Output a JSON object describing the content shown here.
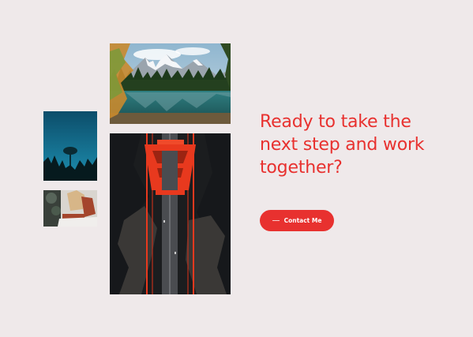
{
  "photos": [
    {
      "name": "photo-mountain-lake",
      "alt": "mountain-lake-photo"
    },
    {
      "name": "photo-tree-sky",
      "alt": "tree-silhouette-photo"
    },
    {
      "name": "photo-person-reading",
      "alt": "person-reading-photo"
    },
    {
      "name": "photo-red-bridge",
      "alt": "red-bridge-aerial-photo"
    }
  ],
  "cta": {
    "heading": "Ready to take the next step and work together?",
    "button_label": "Contact Me",
    "accent_color": "#e8312f"
  },
  "colors": {
    "background": "#efe9ea",
    "accent": "#e8312f"
  }
}
